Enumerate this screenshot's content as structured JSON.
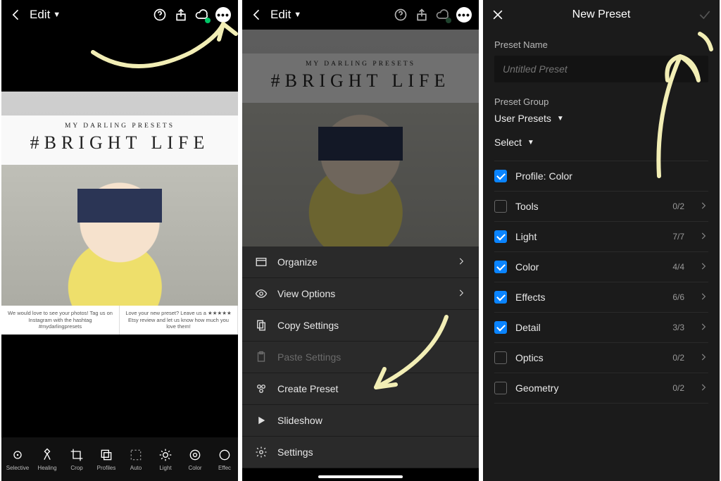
{
  "header": {
    "edit_label": "Edit"
  },
  "phone1": {
    "banner_small": "MY DARLING PRESETS",
    "banner_large": "#BRIGHT LIFE",
    "footer_left": "We would love to see your photos! Tag us on Instagram with the hashtag #mydarlingpresets",
    "footer_right": "Love your new preset? Leave us a ★★★★★ Etsy review and let us know how much you love them!",
    "tools": [
      {
        "label": "Selective"
      },
      {
        "label": "Healing"
      },
      {
        "label": "Crop"
      },
      {
        "label": "Profiles"
      },
      {
        "label": "Auto"
      },
      {
        "label": "Light"
      },
      {
        "label": "Color"
      },
      {
        "label": "Effec"
      }
    ]
  },
  "phone2": {
    "menu": {
      "organize": "Organize",
      "view_options": "View Options",
      "copy_settings": "Copy Settings",
      "paste_settings": "Paste Settings",
      "create_preset": "Create Preset",
      "slideshow": "Slideshow",
      "settings": "Settings"
    }
  },
  "phone3": {
    "title": "New Preset",
    "preset_name_label": "Preset Name",
    "preset_name_placeholder": "Untitled Preset",
    "preset_group_label": "Preset Group",
    "preset_group_value": "User Presets",
    "select_label": "Select",
    "options": [
      {
        "name": "Profile: Color",
        "checked": true,
        "count": ""
      },
      {
        "name": "Tools",
        "checked": false,
        "count": "0/2"
      },
      {
        "name": "Light",
        "checked": true,
        "count": "7/7"
      },
      {
        "name": "Color",
        "checked": true,
        "count": "4/4"
      },
      {
        "name": "Effects",
        "checked": true,
        "count": "6/6"
      },
      {
        "name": "Detail",
        "checked": true,
        "count": "3/3"
      },
      {
        "name": "Optics",
        "checked": false,
        "count": "0/2"
      },
      {
        "name": "Geometry",
        "checked": false,
        "count": "0/2"
      }
    ]
  }
}
